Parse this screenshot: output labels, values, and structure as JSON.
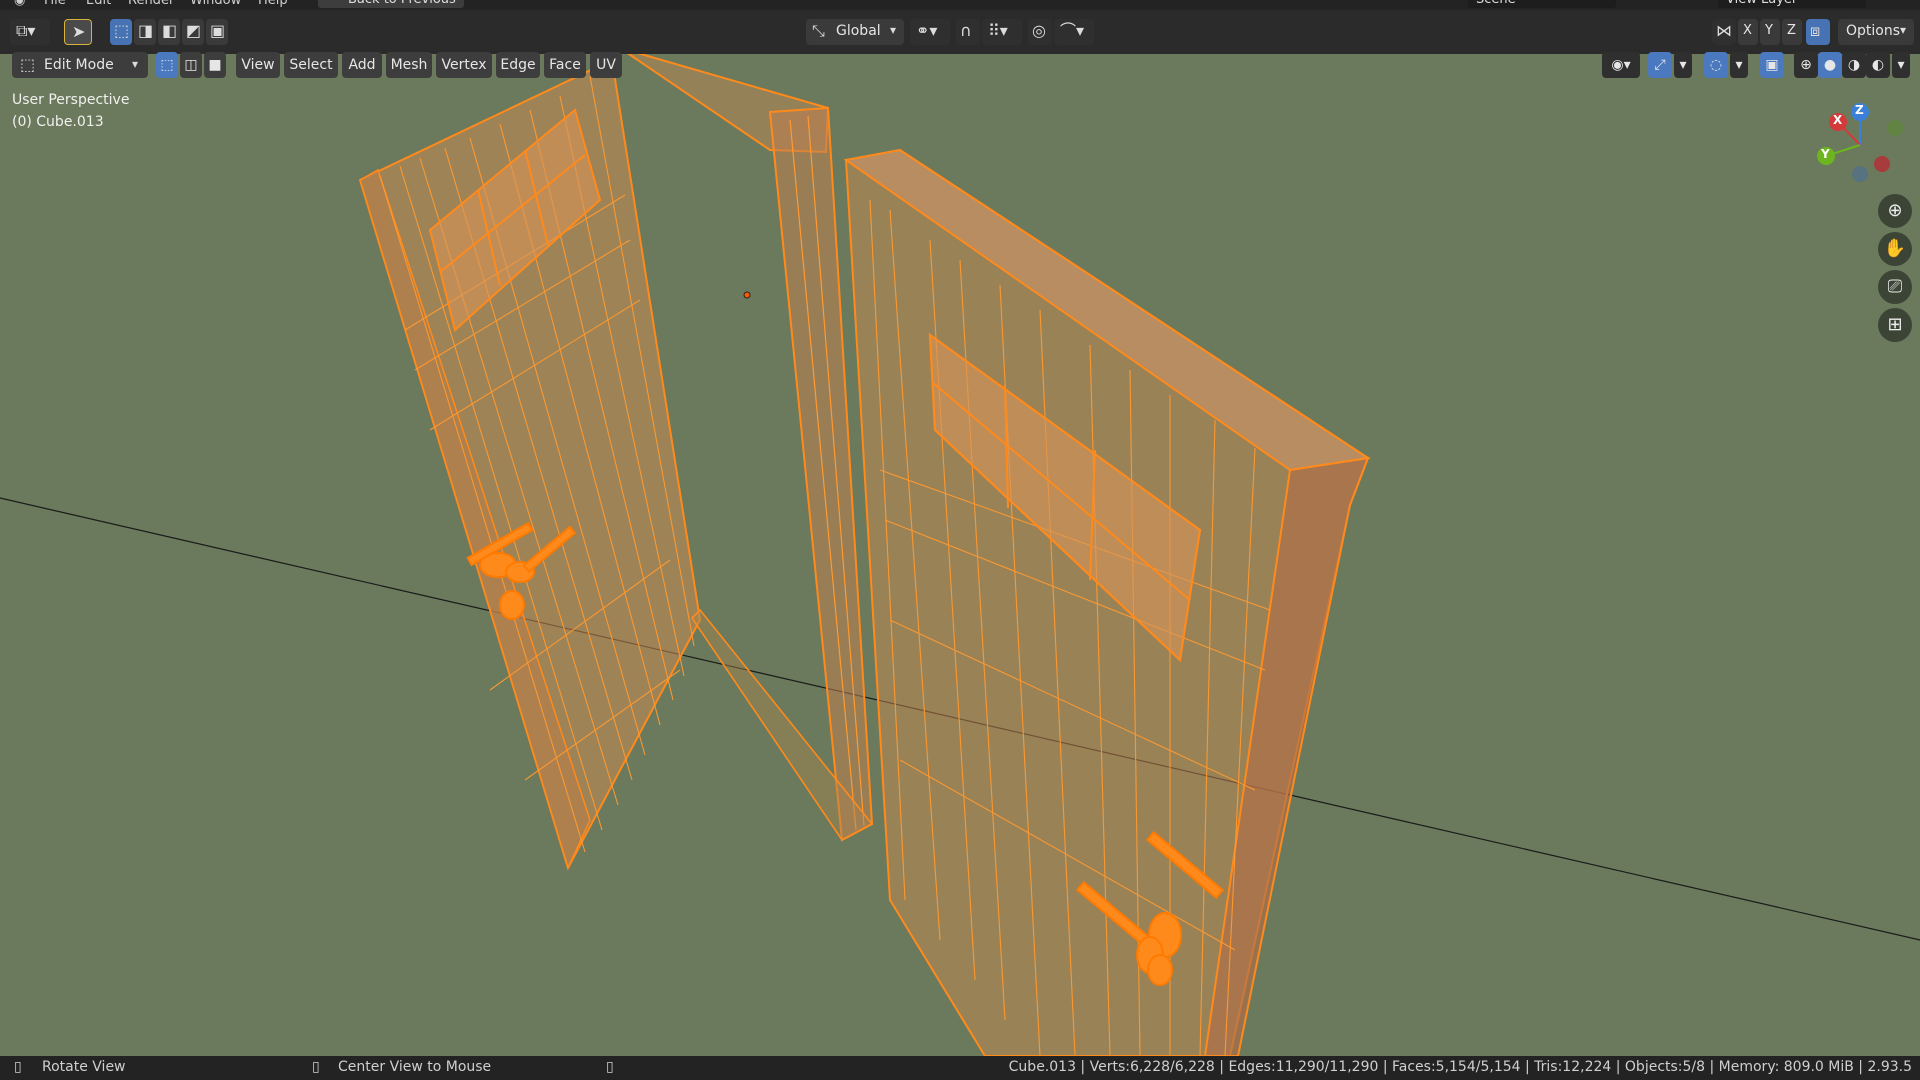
{
  "top_menu": [
    "File",
    "Edit",
    "Render",
    "Window",
    "Help"
  ],
  "back_button": "Back to Previous",
  "scene_name": "Scene",
  "view_layer": "View Layer",
  "toolbar": {
    "transform_orientation": "Global",
    "axes": [
      "X",
      "Y",
      "Z"
    ],
    "options_label": "Options"
  },
  "header": {
    "mode": "Edit Mode",
    "menus": [
      "View",
      "Select",
      "Add",
      "Mesh",
      "Vertex",
      "Edge",
      "Face",
      "UV"
    ]
  },
  "viewport": {
    "perspective_label": "User Perspective",
    "object_label": "(0) Cube.013",
    "gizmo_axes": [
      "X",
      "Y",
      "Z"
    ]
  },
  "status": {
    "left_action": "Rotate View",
    "middle_action": "Center View to Mouse",
    "stats": "Cube.013 | Verts:6,228/6,228 | Edges:11,290/11,290 | Faces:5,154/5,154 | Tris:12,224 | Objects:5/8 | Memory: 809.0 MiB | 2.93.5"
  },
  "colors": {
    "viewport_bg": "#6b7a5c",
    "wire_orange": "#ff8a1c",
    "selected_blue": "#4772b3"
  }
}
